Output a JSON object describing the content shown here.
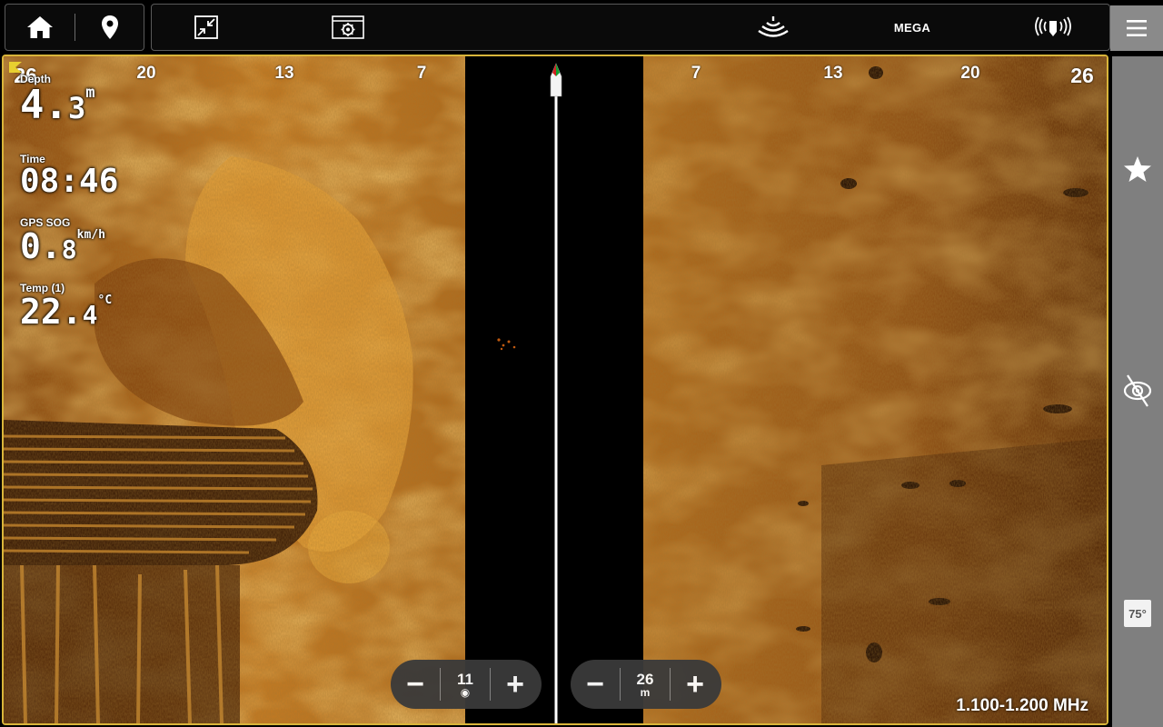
{
  "topbar": {
    "home_icon": "home-icon",
    "waypoint_icon": "map-pin-icon",
    "shrink_icon": "collapse-view-icon",
    "settings_icon": "sonar-settings-icon",
    "sonar_icon": "sonar-ping-icon",
    "mega_label": "MEGA",
    "transducer_icon": "transducer-signal-icon",
    "menu_icon": "hamburger-menu-icon"
  },
  "sidepanel": {
    "favorite_icon": "star-icon",
    "scan_icon": "side-imaging-icon",
    "angle_label": "75°"
  },
  "sonar": {
    "range_left": [
      "26",
      "20",
      "13",
      "7"
    ],
    "range_right": [
      "7",
      "13",
      "20",
      "26"
    ],
    "colors": {
      "bright": "#f0b040",
      "mid": "#b76a18",
      "dark": "#5a2a06",
      "water": "#000000",
      "frame": "#d9b53a"
    }
  },
  "data_overlay": {
    "depth": {
      "label": "Depth",
      "value_int": "4.",
      "value_dec": "3",
      "unit": "m"
    },
    "time": {
      "label": "Time",
      "value": "08:46"
    },
    "sog": {
      "label": "GPS SOG",
      "value_int": "0.",
      "value_dec": "8",
      "unit": "km/h"
    },
    "temp": {
      "label": "Temp (1)",
      "value_int": "22.",
      "value_dec": "4",
      "unit": "°C"
    }
  },
  "controls": {
    "left_pill": {
      "minus": "−",
      "value": "11",
      "sub": "◉",
      "plus": "+"
    },
    "right_pill": {
      "minus": "−",
      "value": "26",
      "sub": "m",
      "plus": "+"
    }
  },
  "frequency": "1.100-1.200 MHz"
}
